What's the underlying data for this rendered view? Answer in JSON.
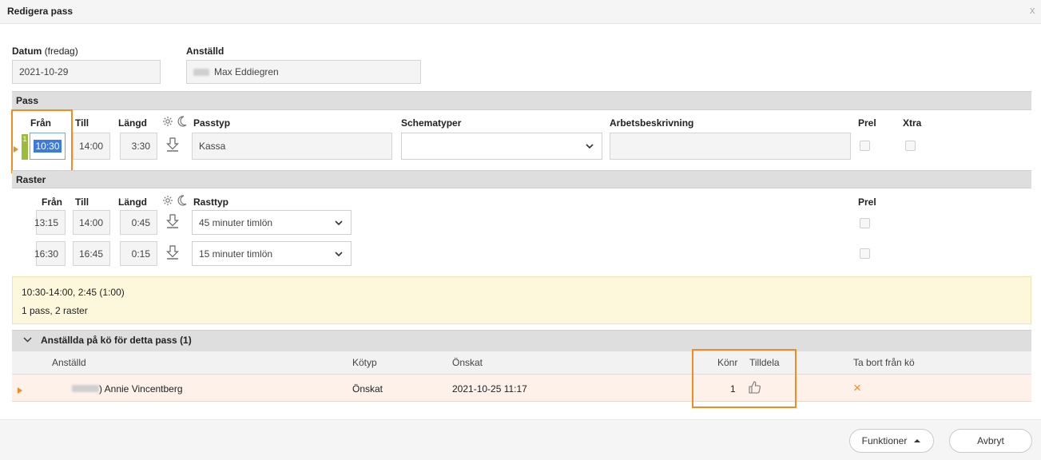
{
  "window": {
    "title": "Redigera pass",
    "close_glyph": "x"
  },
  "header": {
    "date_label_bold": "Datum",
    "date_label_suffix": "(fredag)",
    "date_value": "2021-10-29",
    "employee_label": "Anställd",
    "employee_value": "Max Eddiegren"
  },
  "pass": {
    "section_title": "Pass",
    "columns": {
      "from": "Från",
      "to": "Till",
      "length": "Längd",
      "type": "Passtyp",
      "schedule_types": "Schematyper",
      "work_description": "Arbetsbeskrivning",
      "prel": "Prel",
      "xtra": "Xtra"
    },
    "row": {
      "badge": "1",
      "from": "10:30",
      "to": "14:00",
      "length": "3:30",
      "type": "Kassa",
      "schedule_type": "",
      "work_description": ""
    }
  },
  "raster": {
    "section_title": "Raster",
    "columns": {
      "from": "Från",
      "to": "Till",
      "length": "Längd",
      "type": "Rasttyp",
      "prel": "Prel"
    },
    "rows": [
      {
        "from": "13:15",
        "to": "14:00",
        "length": "0:45",
        "type": "45 minuter timlön"
      },
      {
        "from": "16:30",
        "to": "16:45",
        "length": "0:15",
        "type": "15 minuter timlön"
      }
    ]
  },
  "summary": {
    "line1": "10:30-14:00, 2:45 (1:00)",
    "line2": "1 pass, 2 raster"
  },
  "queue": {
    "title": "Anställda på kö för detta pass",
    "count": "(1)",
    "columns": {
      "employee": "Anställd",
      "queue_type": "Kötyp",
      "wished": "Önskat",
      "queue_no": "Könr",
      "assign": "Tilldela",
      "remove": "Ta bort från kö"
    },
    "rows": [
      {
        "employee": ") Annie Vincentberg",
        "queue_type": "Önskat",
        "wished": "2021-10-25 11:17",
        "queue_no": "1",
        "remove_glyph": "×"
      }
    ]
  },
  "footer": {
    "functions_label": "Funktioner",
    "cancel_label": "Avbryt"
  },
  "colors": {
    "highlight_orange": "#f28c22",
    "info_bg": "#fdf8dc",
    "queue_row_bg": "#fdf1ea",
    "section_bg": "#dedede"
  },
  "icons": [
    "gear-icon",
    "moon-icon",
    "download-arrow-icon",
    "chevron-down-icon",
    "thumbs-up-icon",
    "remove-x-icon",
    "caret-up-icon",
    "row-pointer-icon"
  ]
}
